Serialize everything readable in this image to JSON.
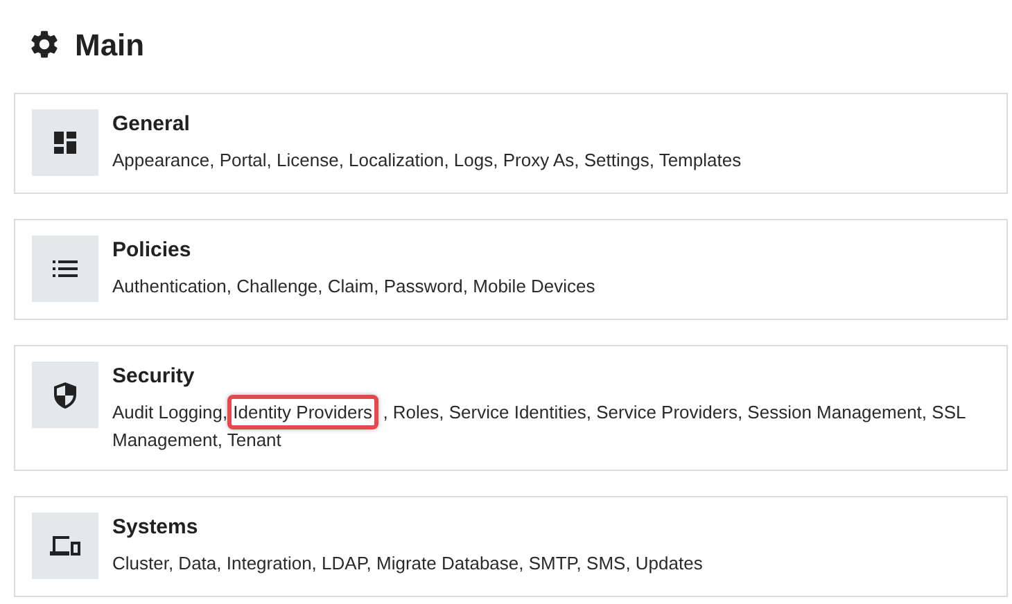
{
  "header": {
    "title": "Main"
  },
  "cards": [
    {
      "kind": "grid",
      "title": "General",
      "segments": [
        {
          "text": "Appearance, Portal, License, Localization, Logs, Proxy As, Settings, Templates",
          "highlighted": false
        }
      ]
    },
    {
      "kind": "list",
      "title": "Policies",
      "segments": [
        {
          "text": "Authentication, Challenge, Claim, Password, Mobile Devices",
          "highlighted": false
        }
      ]
    },
    {
      "kind": "shield",
      "title": "Security",
      "segments": [
        {
          "text": "Audit Logging,",
          "highlighted": false
        },
        {
          "text": "Identity Providers",
          "highlighted": true
        },
        {
          "text": ", Roles, Service Identities, Service Providers, Session Management, SSL",
          "highlighted": false
        },
        {
          "text": "Management, Tenant",
          "highlighted": false
        }
      ]
    },
    {
      "kind": "devices",
      "title": "Systems",
      "segments": [
        {
          "text": "Cluster, Data, Integration, LDAP, Migrate Database, SMTP, SMS, Updates",
          "highlighted": false
        }
      ]
    }
  ]
}
